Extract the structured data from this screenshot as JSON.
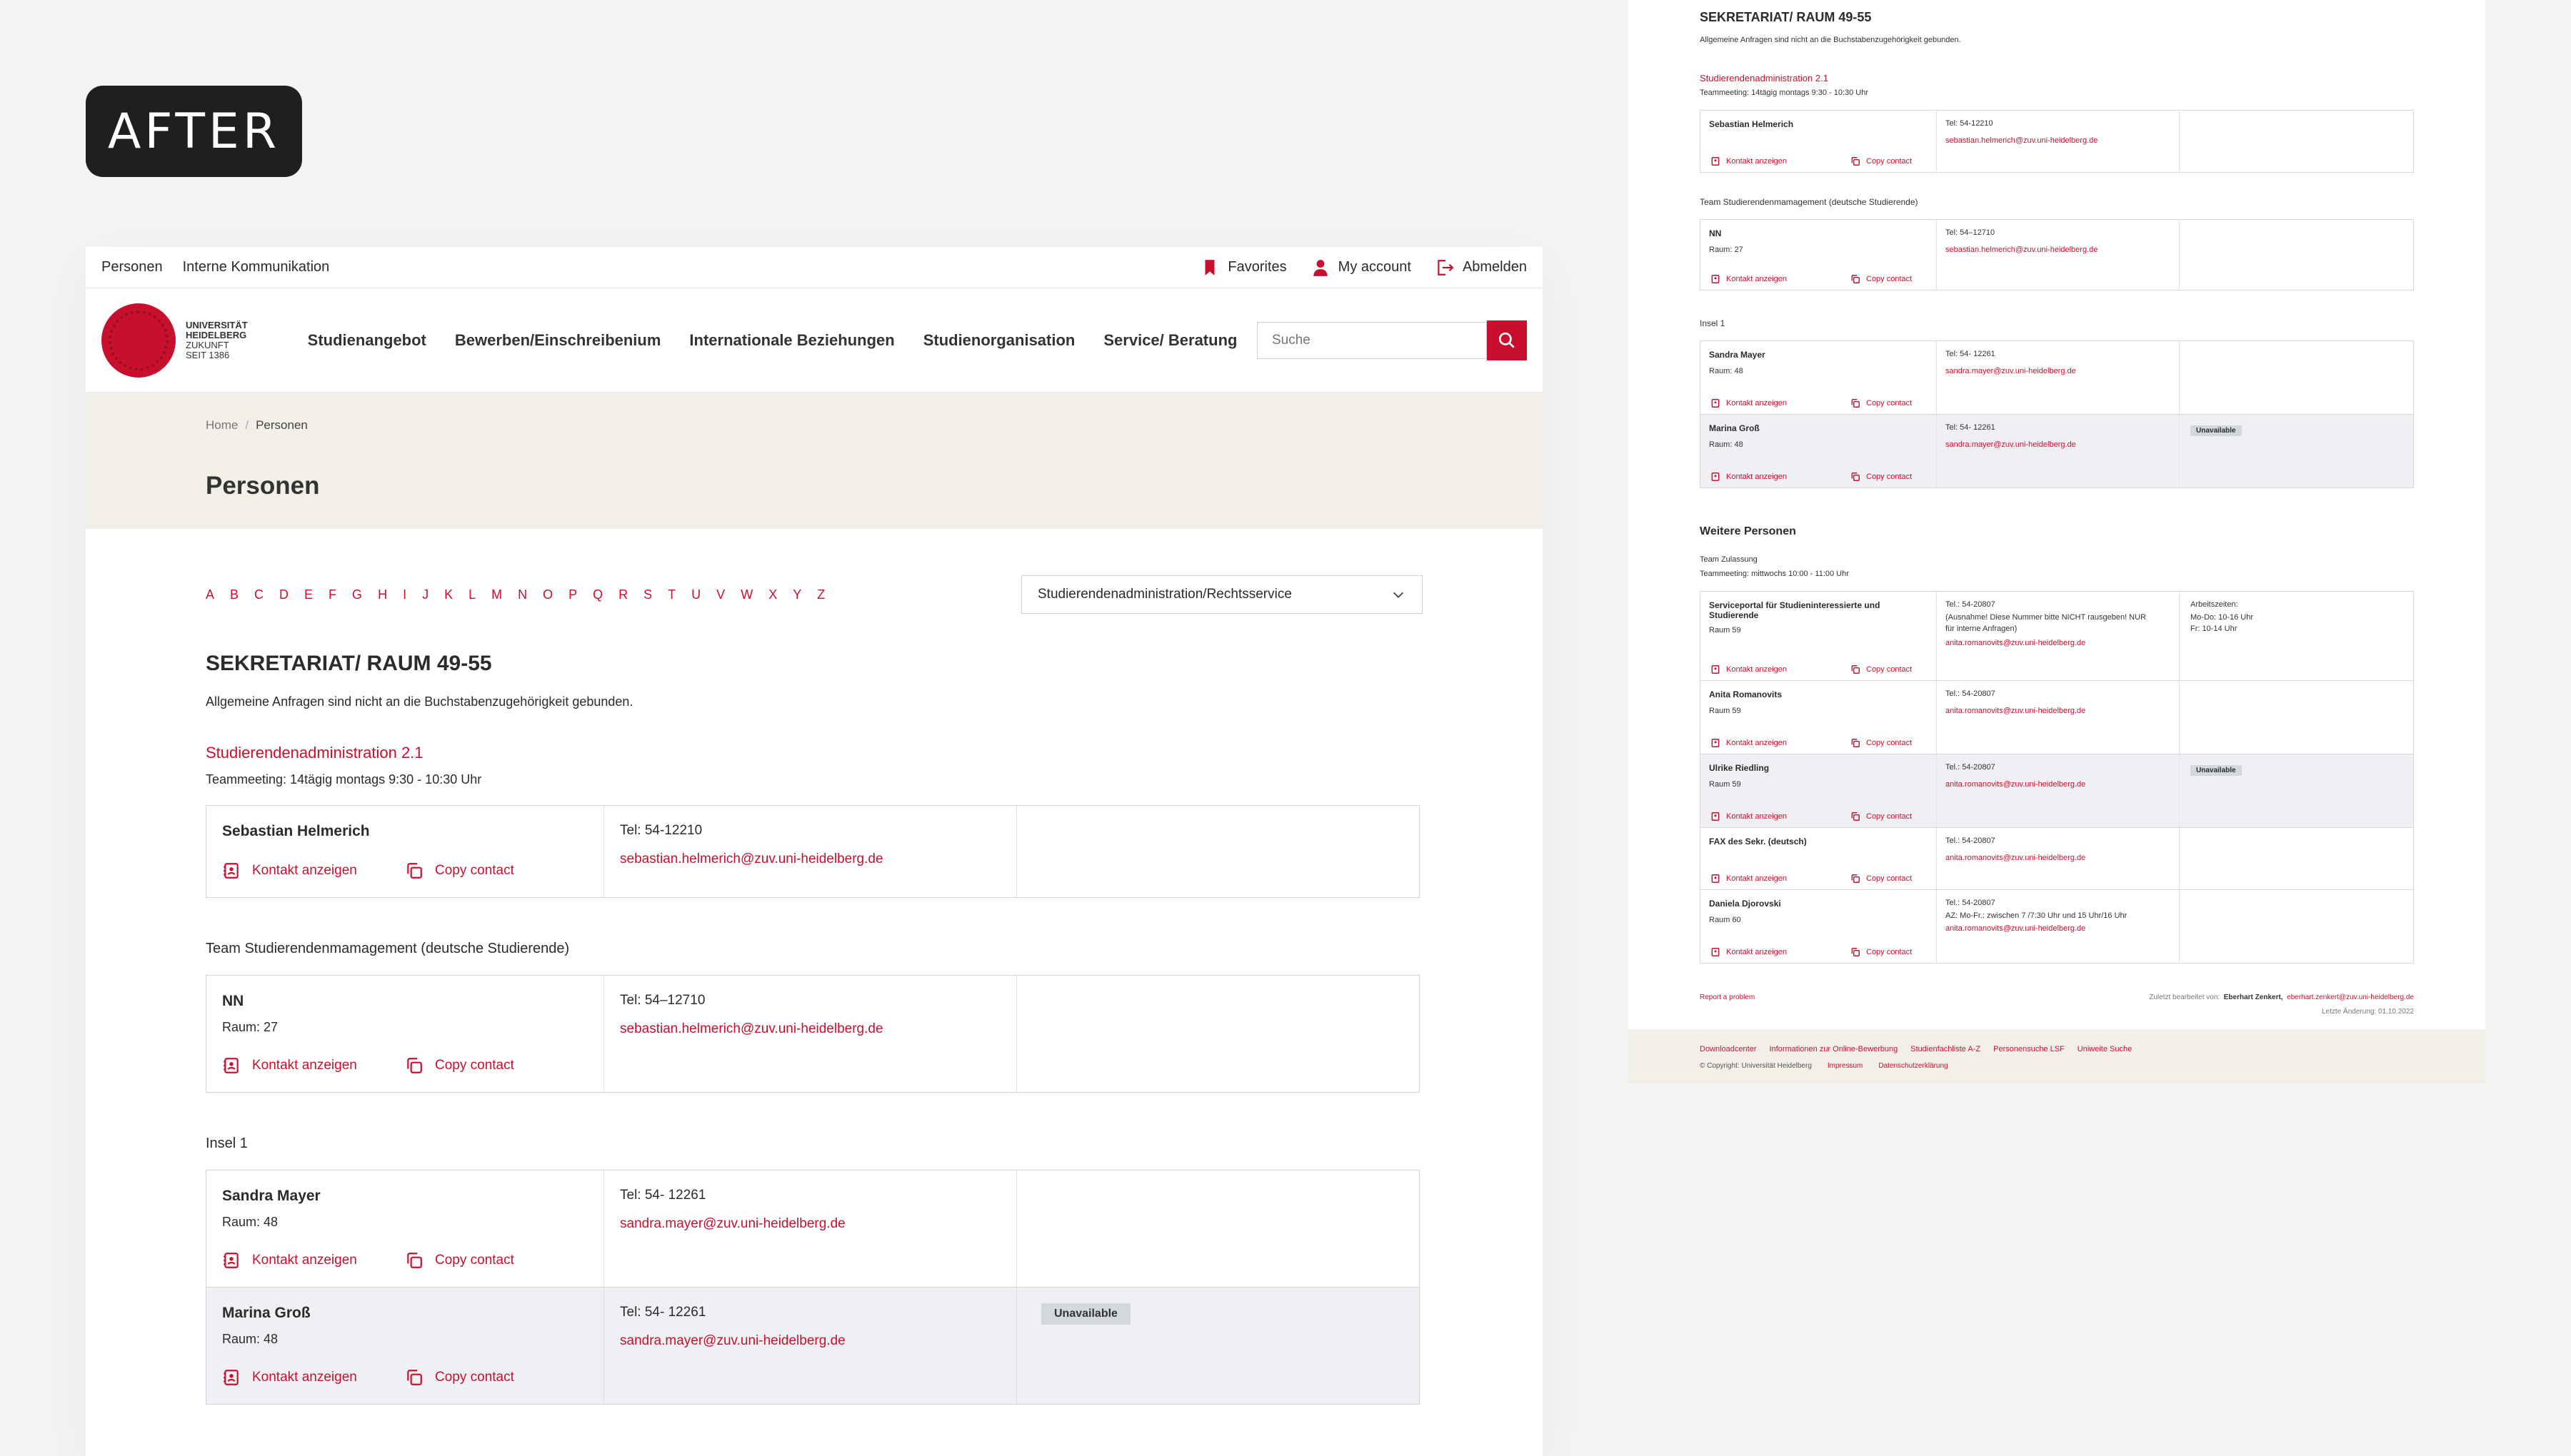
{
  "badge": "AFTER",
  "left": {
    "topbar": {
      "links": [
        "Personen",
        "Interne Kommunikation"
      ],
      "favorites": "Favorites",
      "account": "My account",
      "logout": "Abmelden"
    },
    "logo": {
      "line1": "UNIVERSITÄT",
      "line2": "HEIDELBERG",
      "line3": "ZUKUNFT",
      "line4": "SEIT 1386"
    },
    "nav": [
      "Studienangebot",
      "Bewerben/Einschreibenium",
      "Internationale Beziehungen",
      "Studienorganisation",
      "Service/ Beratung"
    ],
    "search_placeholder": "Suche",
    "breadcrumb": {
      "home": "Home",
      "sep": "/",
      "current": "Personen"
    },
    "title": "Personen",
    "alphabet": [
      "A",
      "B",
      "C",
      "D",
      "E",
      "F",
      "G",
      "H",
      "I",
      "J",
      "K",
      "L",
      "M",
      "N",
      "O",
      "P",
      "Q",
      "R",
      "S",
      "T",
      "U",
      "V",
      "W",
      "X",
      "Y",
      "Z"
    ],
    "dropdown": "Studierendenadministration/Rechtsservice",
    "section_title": "SEKRETARIAT/ RAUM 49-55",
    "section_desc": "Allgemeine Anfragen sind nicht an die Buchstabenzugehörigkeit gebunden.",
    "group1": {
      "title": "Studierendenadministration 2.1",
      "sub": "Teammeeting: 14tägig montags 9:30 - 10:30 Uhr"
    },
    "group2": {
      "title": "Team Studierendenmamagement (deutsche Studierende)"
    },
    "group3": {
      "title": "Insel 1"
    },
    "actions": {
      "show": "Kontakt anzeigen",
      "copy": "Copy contact"
    },
    "unavailable": "Unavailable",
    "persons": [
      {
        "name": "Sebastian Helmerich",
        "room": "",
        "tel": "Tel: 54-12210",
        "mail": "sebastian.helmerich@zuv.uni-heidelberg.de"
      },
      {
        "name": "NN",
        "room": "Raum: 27",
        "tel": "Tel: 54–12710",
        "mail": "sebastian.helmerich@zuv.uni-heidelberg.de"
      },
      {
        "name": "Sandra Mayer",
        "room": "Raum: 48",
        "tel": "Tel: 54- 12261",
        "mail": "sandra.mayer@zuv.uni-heidelberg.de"
      },
      {
        "name": "Marina Groß",
        "room": "Raum: 48",
        "tel": "Tel: 54- 12261",
        "mail": "sandra.mayer@zuv.uni-heidelberg.de"
      }
    ]
  },
  "right": {
    "section_title": "SEKRETARIAT/ RAUM 49-55",
    "section_desc": "Allgemeine Anfragen sind nicht an die Buchstabenzugehörigkeit gebunden.",
    "group1": {
      "title": "Studierendenadministration 2.1",
      "sub": "Teammeeting: 14tägig montags 9:30 - 10:30 Uhr"
    },
    "group2": "Team Studierendenmamagement (deutsche Studierende)",
    "group3": "Insel 1",
    "weitere": "Weitere Personen",
    "team_zulassung": "Team Zulassung",
    "team_zulassung_sub": "Teammeeting: mittwochs 10:00 - 11:00 Uhr",
    "actions": {
      "show": "Kontakt anzeigen",
      "copy": "Copy contact"
    },
    "unavailable": "Unavailable",
    "p1": {
      "name": "Sebastian Helmerich",
      "tel": "Tel: 54-12210",
      "mail": "sebastian.helmerich@zuv.uni-heidelberg.de"
    },
    "p2": {
      "name": "NN",
      "room": "Raum: 27",
      "tel": "Tel: 54–12710",
      "mail": "sebastian.helmerich@zuv.uni-heidelberg.de"
    },
    "p3": {
      "name": "Sandra Mayer",
      "room": "Raum: 48",
      "tel": "Tel: 54- 12261",
      "mail": "sandra.mayer@zuv.uni-heidelberg.de"
    },
    "p4": {
      "name": "Marina Groß",
      "room": "Raum: 48",
      "tel": "Tel: 54- 12261",
      "mail": "sandra.mayer@zuv.uni-heidelberg.de"
    },
    "w1": {
      "name1": "Serviceportal für Studieninteressierte und",
      "name2": "Studierende",
      "room": "Raum 59",
      "tel": "Tel.: 54-20807",
      "note1": "(Ausnahme! Diese Nummer bitte NICHT rausgeben! NUR",
      "note2": "für interne Anfragen)",
      "mail": "anita.romanovits@zuv.uni-heidelberg.de",
      "hours_title": "Arbeitszeiten:",
      "hours1": "Mo-Do: 10-16 Uhr",
      "hours2": "Fr: 10-14 Uhr"
    },
    "w2": {
      "name": "Anita Romanovits",
      "room": "Raum 59",
      "tel": "Tel.: 54-20807",
      "mail": "anita.romanovits@zuv.uni-heidelberg.de"
    },
    "w3": {
      "name": "Ulrike Riedling",
      "room": "Raum 59",
      "tel": "Tel.: 54-20807",
      "mail": "anita.romanovits@zuv.uni-heidelberg.de"
    },
    "w4": {
      "name": "FAX des Sekr. (deutsch)",
      "tel": "Tel.: 54-20807",
      "mail": "anita.romanovits@zuv.uni-heidelberg.de"
    },
    "w5": {
      "name": "Daniela Djorovski",
      "room": "Raum 60",
      "tel": "Tel.: 54-20807",
      "note": "AZ: Mo-Fr.: zwischen 7 /7:30 Uhr und 15 Uhr/16 Uhr",
      "mail": "anita.romanovits@zuv.uni-heidelberg.de"
    },
    "report": "Report a problem",
    "edited_label": "Zuletzt bearbeitet von:",
    "edited_by": "Eberhart Zenkert,",
    "edited_mail": "eberhart.zenkert@zuv.uni-heidelberg.de",
    "last_change": "Letzte Änderung:  01.10.2022",
    "footer_links": [
      "Downloadcenter",
      "Informationen zur Online-Bewerbung",
      "Studienfachliste A-Z",
      "Personensuche LSF",
      "Uniweite Suche"
    ],
    "footer_copy": "© Copyright: Universität Heidelberg",
    "footer_impressum": "Impressum",
    "footer_privacy": "Datenschutzerklärung"
  }
}
